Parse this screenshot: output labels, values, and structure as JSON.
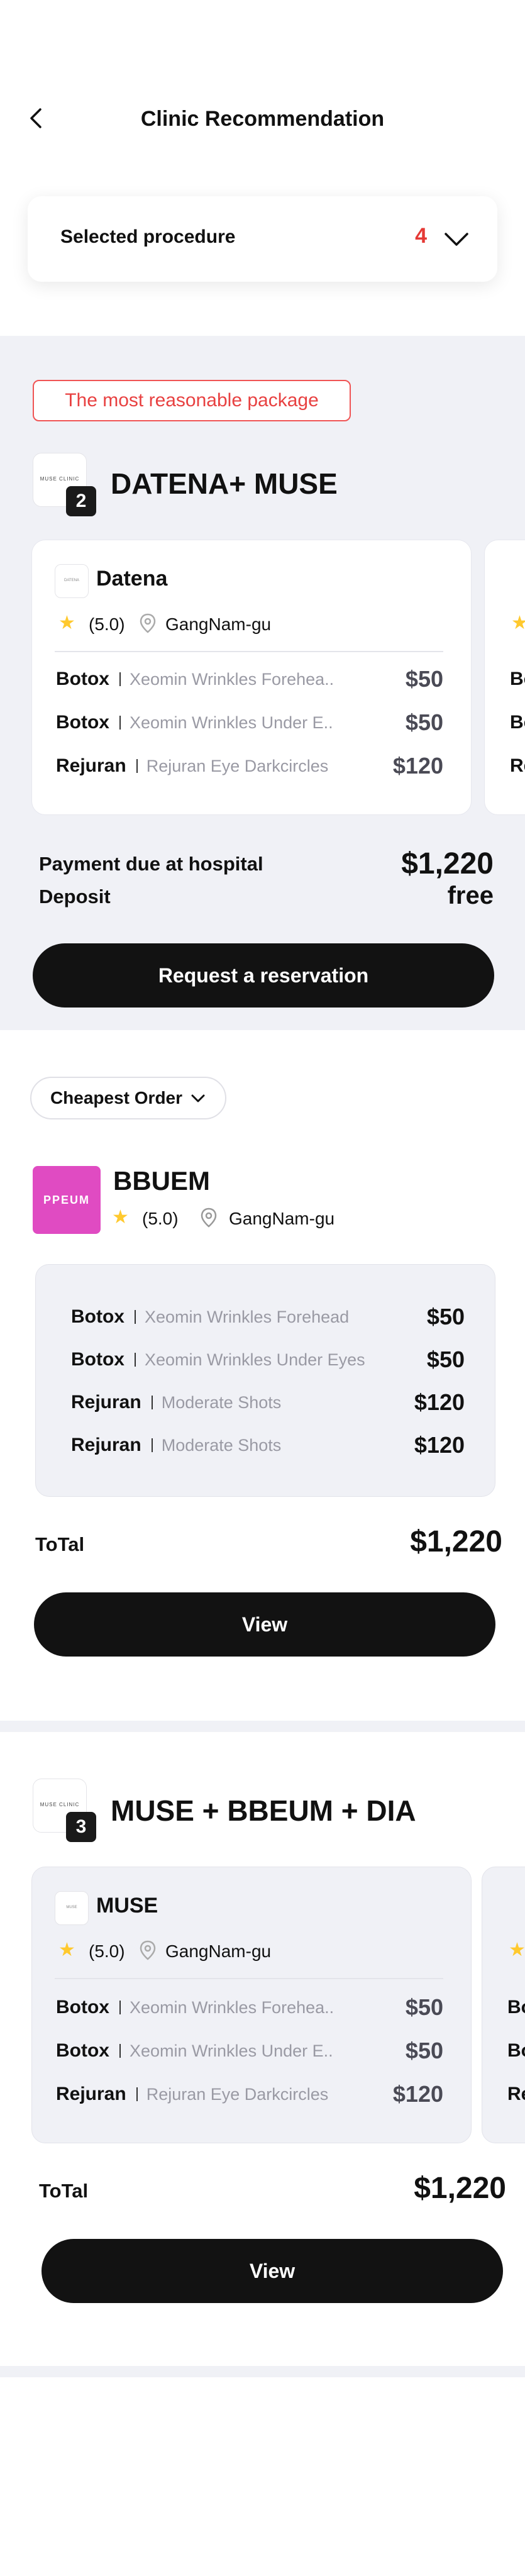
{
  "header": {
    "title": "Clinic Recommendation"
  },
  "selected_procedure": {
    "label": "Selected procedure",
    "count": "4"
  },
  "package1": {
    "badge": "The most reasonable package",
    "title": "DATENA+ MUSE",
    "count": "2",
    "logo_text": "MUSE CLINIC",
    "card": {
      "name": "Datena",
      "rating": "(5.0)",
      "location": "GangNam-gu",
      "items": [
        {
          "proc": "Botox",
          "desc": "Xeomin Wrinkles Forehea..",
          "price": "$50"
        },
        {
          "proc": "Botox",
          "desc": "Xeomin Wrinkles Under E..",
          "price": "$50"
        },
        {
          "proc": "Rejuran",
          "desc": "Rejuran Eye Darkcircles",
          "price": "$120"
        }
      ]
    },
    "peek_items": [
      "Bo",
      "Bo",
      "Re"
    ],
    "payment_label": "Payment due at hospital",
    "payment_value": "$1,220",
    "deposit_label": "Deposit",
    "deposit_value": "free",
    "button": "Request a reservation"
  },
  "sort": {
    "label": "Cheapest Order"
  },
  "clinic2": {
    "logo_text": "PPEUM",
    "name": "BBUEM",
    "rating": "(5.0)",
    "location": "GangNam-gu",
    "items": [
      {
        "proc": "Botox",
        "desc": "Xeomin Wrinkles Forehead",
        "price": "$50"
      },
      {
        "proc": "Botox",
        "desc": "Xeomin Wrinkles Under Eyes",
        "price": "$50"
      },
      {
        "proc": "Rejuran",
        "desc": "Moderate Shots",
        "price": "$120"
      },
      {
        "proc": "Rejuran",
        "desc": "Moderate Shots",
        "price": "$120"
      }
    ],
    "total_label": "ToTal",
    "total_value": "$1,220",
    "button": "View"
  },
  "package3": {
    "title": "MUSE + BBEUM + DIA",
    "count": "3",
    "logo_text": "MUSE CLINIC",
    "card": {
      "name": "MUSE",
      "rating": "(5.0)",
      "location": "GangNam-gu",
      "items": [
        {
          "proc": "Botox",
          "desc": "Xeomin Wrinkles Forehea..",
          "price": "$50"
        },
        {
          "proc": "Botox",
          "desc": "Xeomin Wrinkles Under E..",
          "price": "$50"
        },
        {
          "proc": "Rejuran",
          "desc": "Rejuran Eye Darkcircles",
          "price": "$120"
        }
      ]
    },
    "peek_items": [
      "Bo",
      "Bo",
      "Re"
    ],
    "total_label": "ToTal",
    "total_value": "$1,220",
    "button": "View"
  },
  "colors": {
    "accent_red": "#e53935",
    "star": "#ffc92e",
    "brand_pink": "#e04bc2",
    "button_black": "#121212"
  }
}
